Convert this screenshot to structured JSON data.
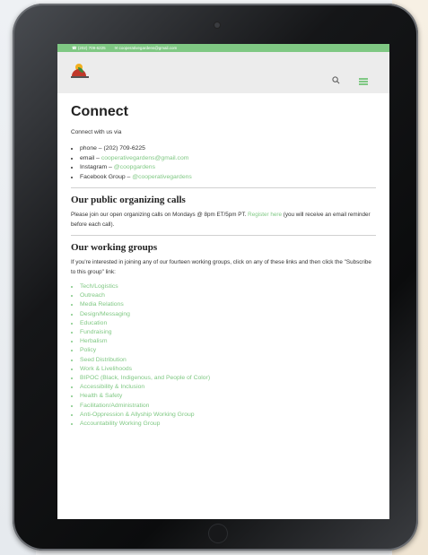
{
  "topbar": {
    "phone": "(202) 709-6225",
    "email": "cooperativegardens@gmail.com"
  },
  "header": {
    "logo_icon": "cooperative-gardens-logo",
    "search_icon": "search-icon",
    "menu_icon": "hamburger-icon"
  },
  "page": {
    "title": "Connect",
    "intro": "Connect with us via",
    "contacts": [
      {
        "label": "phone – ",
        "value": "(202) 709-6225"
      },
      {
        "label": "email – ",
        "value": "cooperativegardens@gmail.com"
      },
      {
        "label": "Instagram – ",
        "value": "@coopgardens"
      },
      {
        "label": "Facebook Group – ",
        "value": "@cooperativegardens"
      }
    ]
  },
  "calls": {
    "heading": "Our public organizing calls",
    "text_before": "Please join our open organizing calls on Mondays @ 8pm ET/5pm PT. ",
    "link": "Register here",
    "text_after": " (you will receive an email reminder before each call)."
  },
  "groups": {
    "heading": "Our working groups",
    "text": "If you're interested in joining any of our fourteen working groups, click on any of these links and then click the \"Subscribe to this group\" link:",
    "items": [
      "Tech/Logistics",
      "Outreach",
      "Media Relations",
      "Design/Messaging",
      "Education",
      "Fundraising",
      "Herbalism",
      "Policy",
      "Seed Distribution",
      "Work & Livelihoods",
      "BIPOC (Black, Indigenous, and People of Color)",
      "Accessibility & Inclusion",
      "Health & Safety",
      "Facilitation/Administration",
      "Anti-Oppression & Allyship Working Group",
      "Accountability Working Group"
    ]
  },
  "colors": {
    "accent": "#7fc883",
    "header_bg": "#ececec",
    "bezel": "#0b0c0d"
  }
}
